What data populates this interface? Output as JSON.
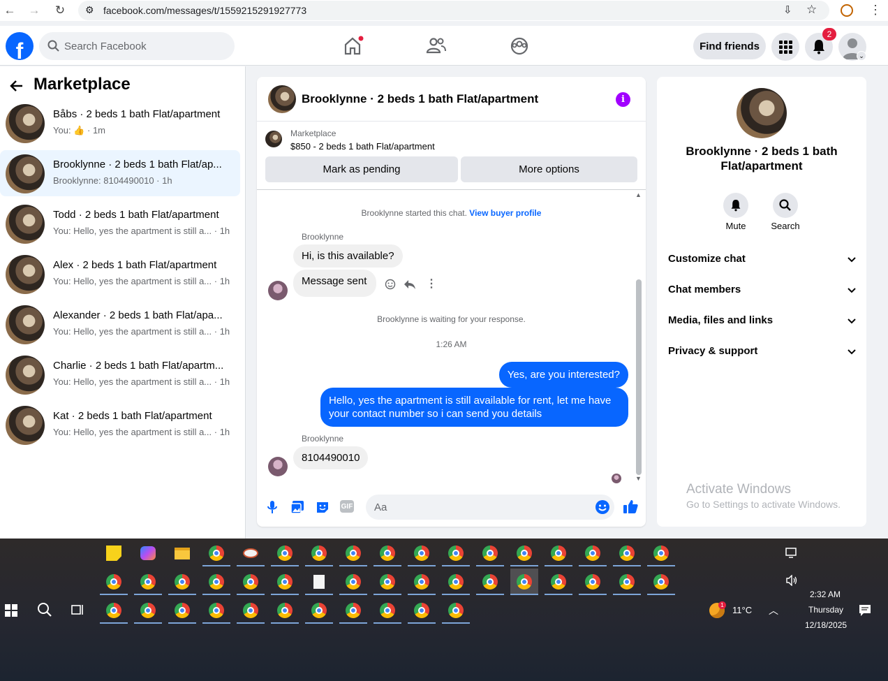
{
  "browser": {
    "url": "facebook.com/messages/t/1559215291927773"
  },
  "header": {
    "search_placeholder": "Search Facebook",
    "find_friends": "Find friends",
    "notification_count": "2"
  },
  "sidebar": {
    "title": "Marketplace",
    "conversations": [
      {
        "name": "Båbs · 2 beds 1 bath Flat/apartment",
        "preview": "You:",
        "time": "· 1m",
        "has_like": true
      },
      {
        "name": "Brooklynne · 2 beds 1 bath Flat/ap...",
        "preview": "Brooklynne: 8104490010 · 1h",
        "time": "",
        "active": true
      },
      {
        "name": "Todd · 2 beds 1 bath Flat/apartment",
        "preview": "You: Hello, yes the apartment is still a...",
        "time": "· 1h"
      },
      {
        "name": "Alex · 2 beds 1 bath Flat/apartment",
        "preview": "You: Hello, yes the apartment is still a...",
        "time": "· 1h"
      },
      {
        "name": "Alexander · 2 beds 1 bath Flat/apa...",
        "preview": "You: Hello, yes the apartment is still a...",
        "time": "· 1h"
      },
      {
        "name": "Charlie · 2 beds 1 bath Flat/apartm...",
        "preview": "You: Hello, yes the apartment is still a...",
        "time": "· 1h"
      },
      {
        "name": "Kat · 2 beds 1 bath Flat/apartment",
        "preview": "You: Hello, yes the apartment is still a...",
        "time": "· 1h"
      }
    ]
  },
  "chat": {
    "title": "Brooklynne · 2 beds 1 bath Flat/apartment",
    "marketplace_label": "Marketplace",
    "listing": "$850 - 2 beds 1 bath Flat/apartment",
    "mark_pending": "Mark as pending",
    "more_options": "More options",
    "started_text": "Brooklynne started this chat.",
    "view_profile": "View buyer profile",
    "sender": "Brooklynne",
    "msg1": "Hi, is this available?",
    "msg2": "Message sent",
    "waiting": "Brooklynne is waiting for your response.",
    "timestamp": "1:26 AM",
    "out1": "Yes, are you interested?",
    "out2": "Hello, yes the apartment is still available for rent, let me have your contact number so i can send you details",
    "msg3": "8104490010",
    "composer_placeholder": "Aa"
  },
  "details": {
    "title": "Brooklynne · 2 beds 1 bath Flat/apartment",
    "mute": "Mute",
    "search": "Search",
    "sections": [
      "Customize chat",
      "Chat members",
      "Media, files and links",
      "Privacy & support"
    ]
  },
  "watermark": {
    "line1": "Activate Windows",
    "line2": "Go to Settings to activate Windows."
  },
  "taskbar": {
    "weather": "11°C",
    "time": "2:32 AM",
    "day": "Thursday",
    "date": "12/18/2025"
  }
}
